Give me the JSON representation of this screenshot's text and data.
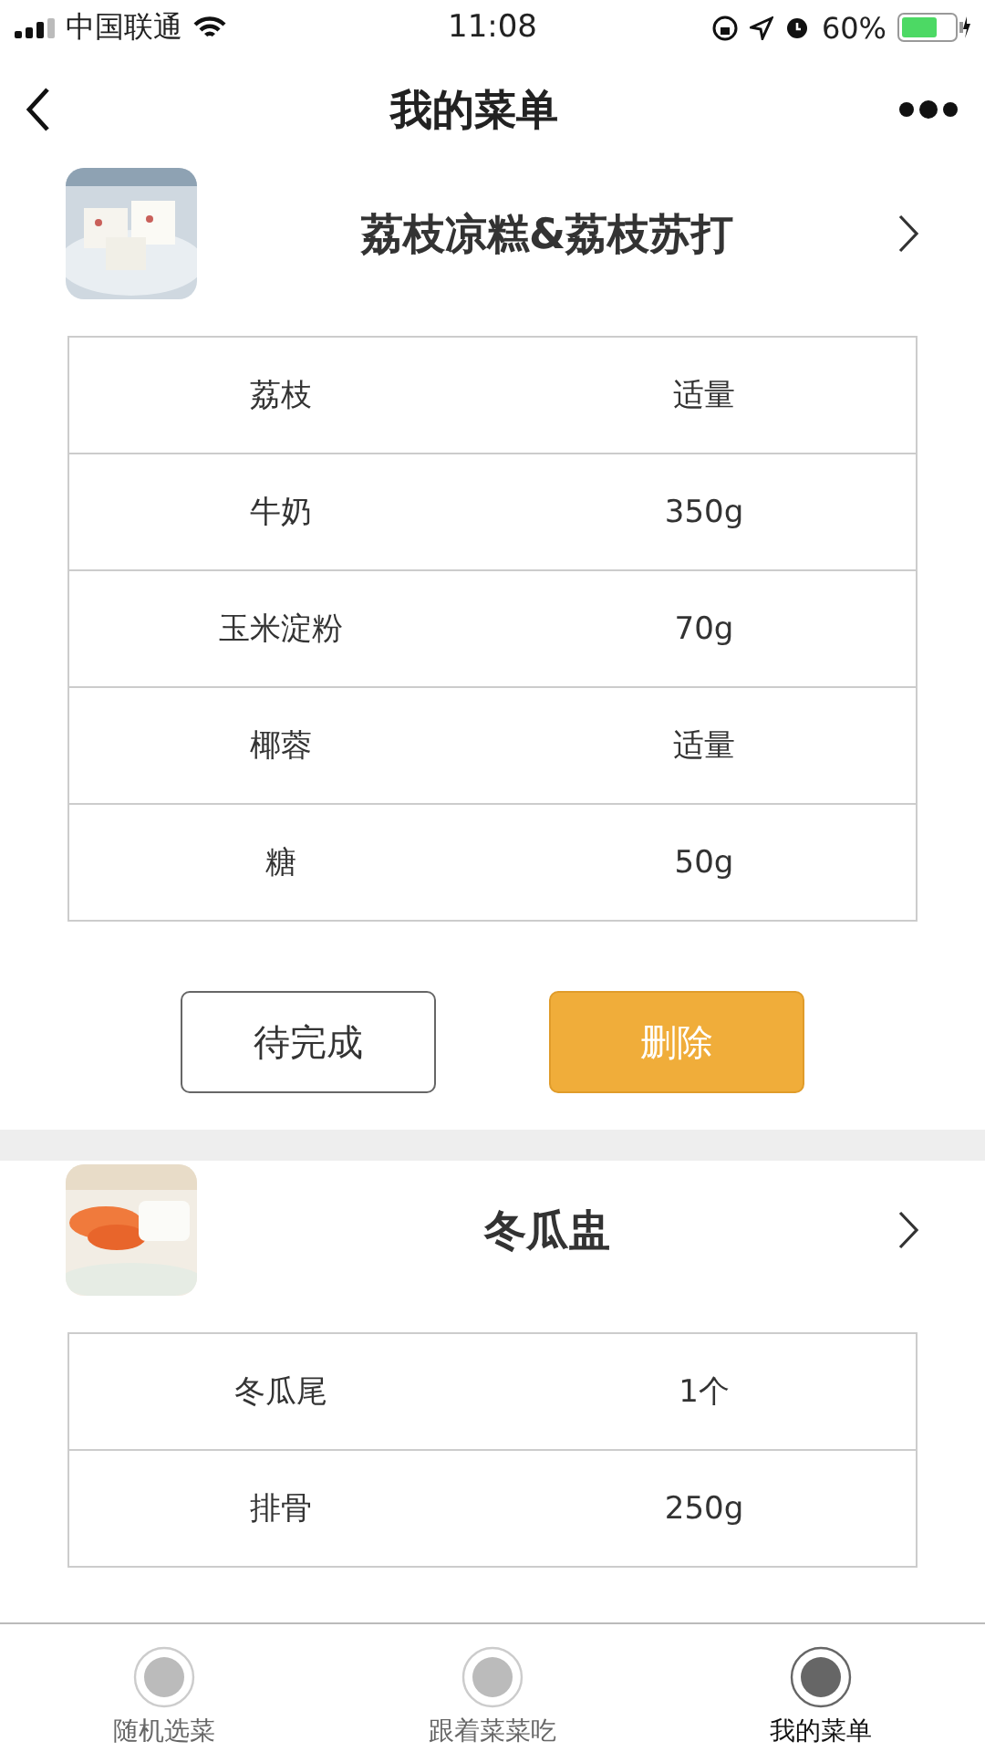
{
  "status_bar": {
    "carrier": "中国联通",
    "time": "11:08",
    "battery": "60%"
  },
  "nav": {
    "title": "我的菜单"
  },
  "dishes": [
    {
      "title": "荔枝凉糕&荔枝苏打",
      "ingredients": [
        {
          "name": "荔枝",
          "amount": "适量"
        },
        {
          "name": "牛奶",
          "amount": "350g"
        },
        {
          "name": "玉米淀粉",
          "amount": "70g"
        },
        {
          "name": "椰蓉",
          "amount": "适量"
        },
        {
          "name": "糖",
          "amount": "50g"
        }
      ],
      "buttons": [
        {
          "label": "待完成",
          "kind": "outline"
        },
        {
          "label": "删除",
          "kind": "primary"
        }
      ]
    },
    {
      "title": "冬瓜盅",
      "ingredients": [
        {
          "name": "冬瓜尾",
          "amount": "1个"
        },
        {
          "name": "排骨",
          "amount": "250g"
        }
      ]
    }
  ],
  "tabs": [
    {
      "label": "随机选菜",
      "selected": false
    },
    {
      "label": "跟着菜菜吃",
      "selected": false
    },
    {
      "label": "我的菜单",
      "selected": true
    }
  ]
}
